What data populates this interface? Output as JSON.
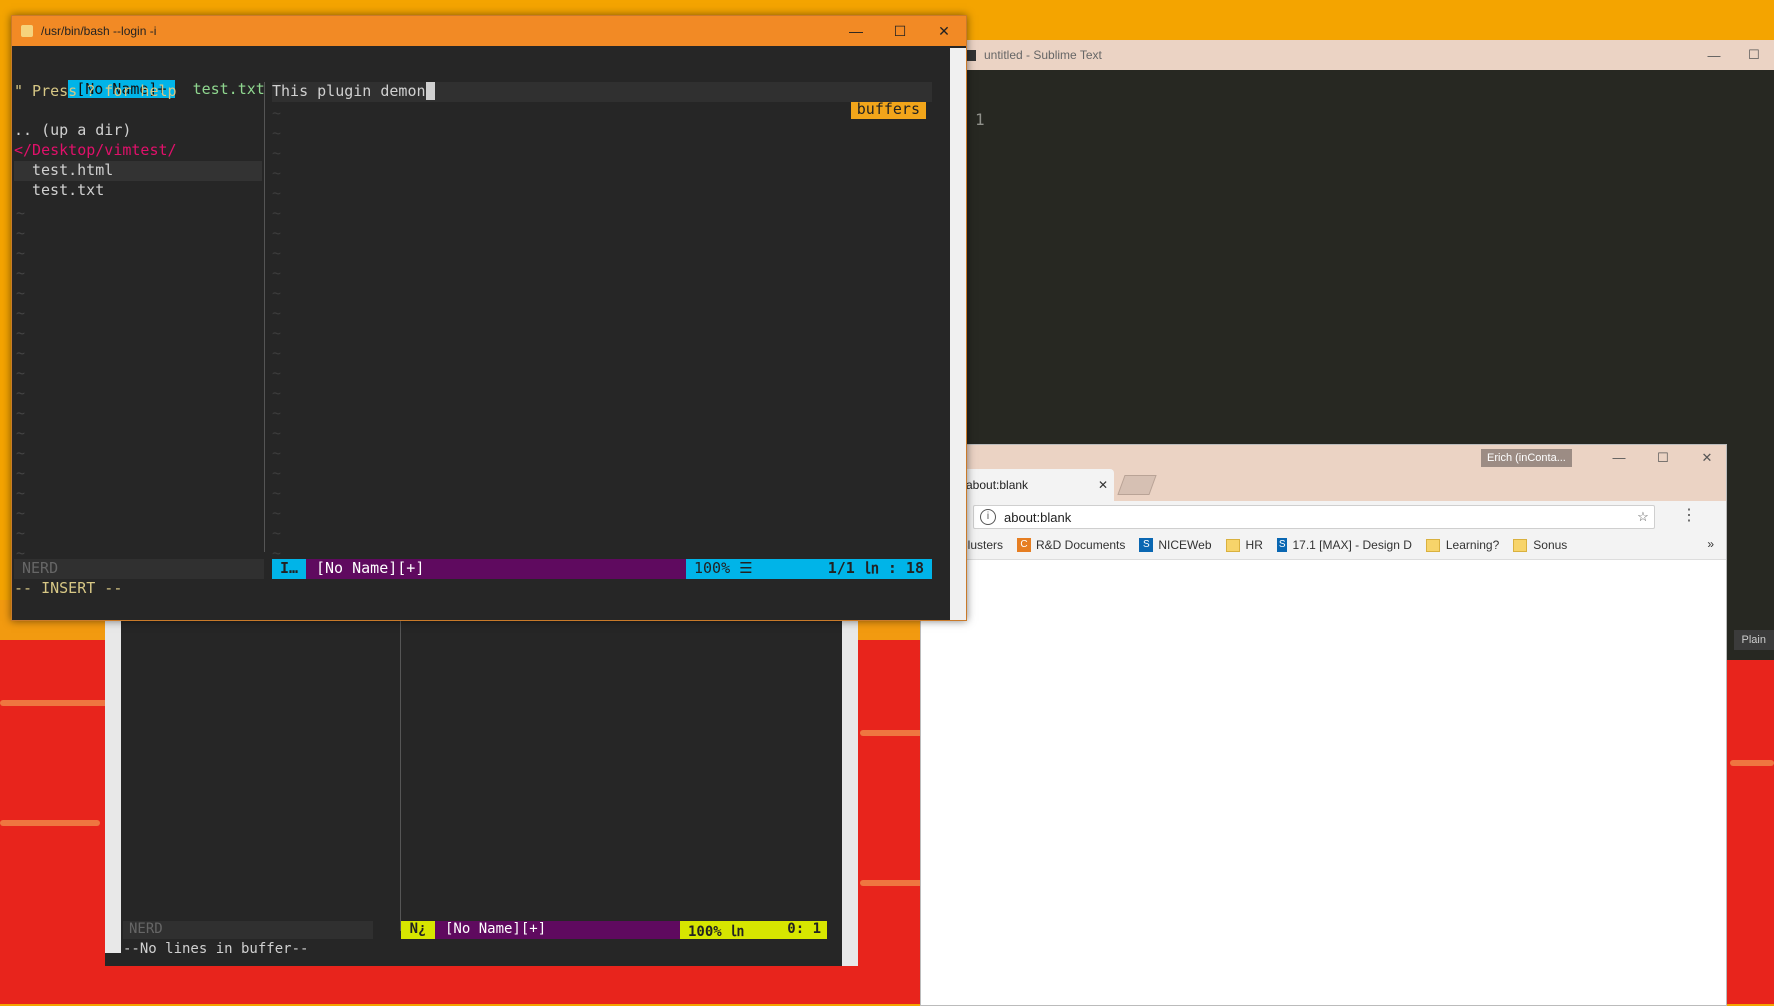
{
  "terminal": {
    "title": "/usr/bin/bash --login -i",
    "tabline": {
      "active_buffer": "[No Name]+",
      "buffers": "test.txt | test.html |",
      "buffers_label": "buffers"
    },
    "nerdtree": {
      "help": "\" Press ? for help",
      "up_dir": ".. (up a dir)",
      "path": "</Desktop/vimtest/",
      "files": [
        "test.html",
        "test.txt"
      ]
    },
    "editor_text": "This plugin demon",
    "statusline": {
      "left": "NERD",
      "mode": "I…",
      "file": "[No Name][+]",
      "percent": "100% ☰",
      "position": "1/1 ㏑ : 18"
    },
    "cmdline": "-- INSERT --"
  },
  "vim2": {
    "statusline": {
      "left": "NERD",
      "mode": "N¿",
      "file": "[No Name][+]",
      "percent": "100% ㏑",
      "position": "0:  1"
    },
    "cmdline": "--No lines in buffer--"
  },
  "sublime": {
    "title": "untitled - Sublime Text",
    "line_number": "1",
    "status_right": "Plain"
  },
  "chrome": {
    "tab_title": "about:blank",
    "profile": "Erich (inConta...",
    "url": "about:blank",
    "bookmarks": [
      {
        "label": "Clusters",
        "kind": "folder"
      },
      {
        "label": "R&D Documents",
        "kind": "icon",
        "color": "#e67e22"
      },
      {
        "label": "NICEWeb",
        "kind": "icon",
        "color": "#0a67b2"
      },
      {
        "label": "HR",
        "kind": "folder"
      },
      {
        "label": "17.1 [MAX] - Design D",
        "kind": "icon",
        "color": "#0a67b2"
      },
      {
        "label": "Learning?",
        "kind": "folder"
      },
      {
        "label": "Sonus",
        "kind": "folder"
      }
    ],
    "more": "»"
  },
  "colors": {
    "terminal_title": "#f28a25",
    "nerd_path": "#e0106a",
    "accent_cyan": "#00b4e8",
    "accent_purple": "#5f0a5f",
    "accent_yellow": "#d7e600"
  }
}
